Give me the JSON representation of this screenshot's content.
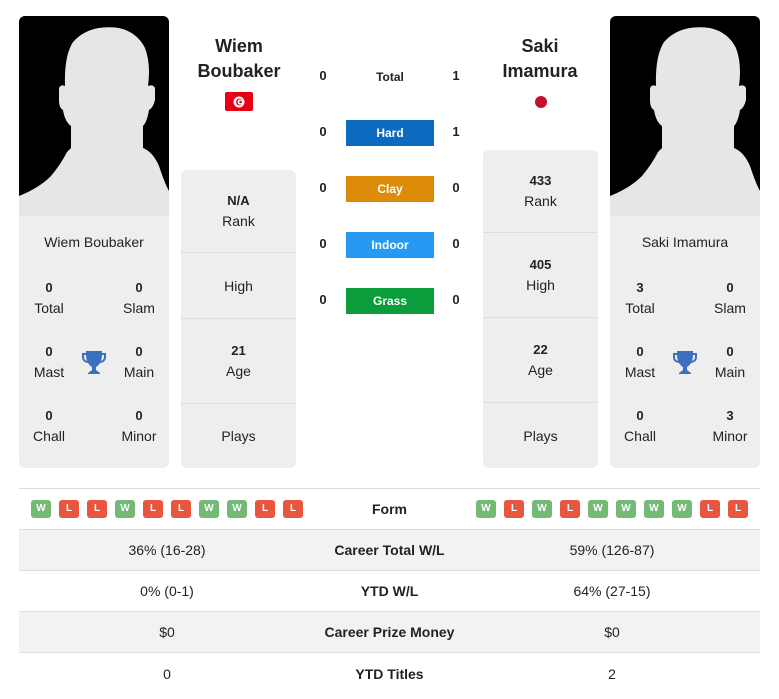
{
  "colors": {
    "hard": "#0c6bbf",
    "clay": "#dd8c09",
    "indoor": "#2699f3",
    "grass": "#0b9c3c",
    "win": "#74b976",
    "loss": "#e8563f",
    "trophy": "#3c6fbd"
  },
  "player1": {
    "name": "Wiem Boubaker",
    "heading_line1": "Wiem",
    "heading_line2": "Boubaker",
    "flag": "tunisia-flag",
    "titles": {
      "total": {
        "value": "0",
        "label": "Total"
      },
      "slam": {
        "value": "0",
        "label": "Slam"
      },
      "mast": {
        "value": "0",
        "label": "Mast"
      },
      "main": {
        "value": "0",
        "label": "Main"
      },
      "chall": {
        "value": "0",
        "label": "Chall"
      },
      "minor": {
        "value": "0",
        "label": "Minor"
      }
    },
    "info": {
      "rank": {
        "value": "N/A",
        "label": "Rank"
      },
      "high": {
        "value": "",
        "label": "High"
      },
      "age": {
        "value": "21",
        "label": "Age"
      },
      "plays": {
        "value": "",
        "label": "Plays"
      }
    },
    "form": [
      "W",
      "L",
      "L",
      "W",
      "L",
      "L",
      "W",
      "W",
      "L",
      "L"
    ]
  },
  "player2": {
    "name": "Saki Imamura",
    "heading_line1": "Saki",
    "heading_line2": "Imamura",
    "flag": "japan-flag",
    "titles": {
      "total": {
        "value": "3",
        "label": "Total"
      },
      "slam": {
        "value": "0",
        "label": "Slam"
      },
      "mast": {
        "value": "0",
        "label": "Mast"
      },
      "main": {
        "value": "0",
        "label": "Main"
      },
      "chall": {
        "value": "0",
        "label": "Chall"
      },
      "minor": {
        "value": "3",
        "label": "Minor"
      }
    },
    "info": {
      "rank": {
        "value": "433",
        "label": "Rank"
      },
      "high": {
        "value": "405",
        "label": "High"
      },
      "age": {
        "value": "22",
        "label": "Age"
      },
      "plays": {
        "value": "",
        "label": "Plays"
      }
    },
    "form": [
      "W",
      "L",
      "W",
      "L",
      "W",
      "W",
      "W",
      "W",
      "L",
      "L"
    ]
  },
  "h2h": [
    {
      "label": "Total",
      "p1": "0",
      "p2": "1",
      "surface": "total"
    },
    {
      "label": "Hard",
      "p1": "0",
      "p2": "1",
      "surface": "hard"
    },
    {
      "label": "Clay",
      "p1": "0",
      "p2": "0",
      "surface": "clay"
    },
    {
      "label": "Indoor",
      "p1": "0",
      "p2": "0",
      "surface": "indoor"
    },
    {
      "label": "Grass",
      "p1": "0",
      "p2": "0",
      "surface": "grass"
    }
  ],
  "stats": {
    "form_label": "Form",
    "rows": [
      {
        "label": "Career Total W/L",
        "p1": "36% (16-28)",
        "p2": "59% (126-87)"
      },
      {
        "label": "YTD W/L",
        "p1": "0% (0-1)",
        "p2": "64% (27-15)"
      },
      {
        "label": "Career Prize Money",
        "p1": "$0",
        "p2": "$0"
      },
      {
        "label": "YTD Titles",
        "p1": "0",
        "p2": "2"
      }
    ]
  }
}
